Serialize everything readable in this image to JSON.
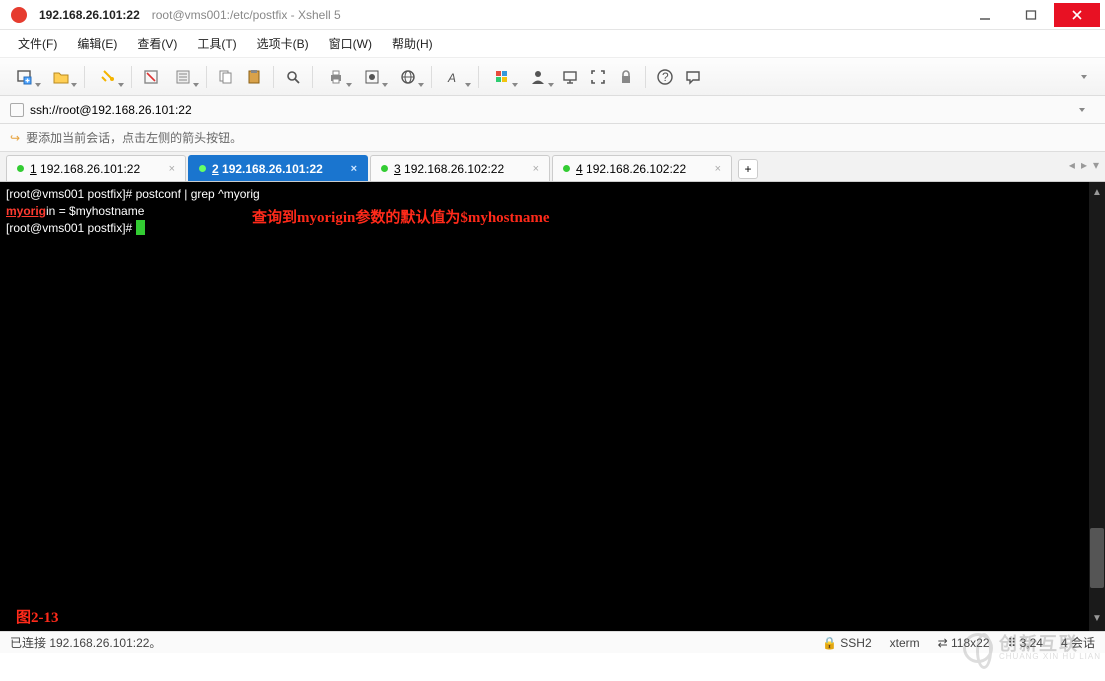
{
  "title": {
    "main": "192.168.26.101:22",
    "sub": "root@vms001:/etc/postfix - Xshell 5"
  },
  "menu": {
    "file": "文件(F)",
    "edit": "编辑(E)",
    "view": "查看(V)",
    "tools": "工具(T)",
    "tabs": "选项卡(B)",
    "window": "窗口(W)",
    "help": "帮助(H)"
  },
  "address": "ssh://root@192.168.26.101:22",
  "hint": "要添加当前会话，点击左侧的箭头按钮。",
  "tabs": [
    {
      "num": "1",
      "label": "192.168.26.101:22",
      "active": false
    },
    {
      "num": "2",
      "label": "192.168.26.101:22",
      "active": true
    },
    {
      "num": "3",
      "label": "192.168.26.102:22",
      "active": false
    },
    {
      "num": "4",
      "label": "192.168.26.102:22",
      "active": false
    }
  ],
  "terminal": {
    "line1": "[root@vms001 postfix]# postconf | grep ^myorig",
    "line2a": "myorig",
    "line2b": "in = $myhostname",
    "line3": "[root@vms001 postfix]# ",
    "annotation": "查询到myorigin参数的默认值为$myhostname",
    "figlabel": "图2-13"
  },
  "status": {
    "conn": "已连接 192.168.26.101:22。",
    "proto": "SSH2",
    "term": "xterm",
    "size": "118x22",
    "pos": "3,24",
    "sess": "4 会话"
  },
  "watermark": {
    "cn": "创新互联",
    "en": "CHUANG XIN HU LIAN"
  },
  "icons": {
    "new": "new-session-icon",
    "open": "open-icon",
    "arrow": "add-arrow-icon",
    "reconnect": "reconnect-icon",
    "disconnect": "disconnect-icon",
    "copy": "copy-icon",
    "paste": "paste-icon",
    "find": "find-icon",
    "print": "print-icon",
    "props": "properties-icon",
    "lang": "language-icon",
    "font": "font-icon",
    "color": "color-scheme-icon",
    "user": "user-icon",
    "host": "host-icon",
    "fullscreen": "fullscreen-icon",
    "lock": "lock-icon",
    "help": "help-icon",
    "chat": "chat-icon"
  }
}
